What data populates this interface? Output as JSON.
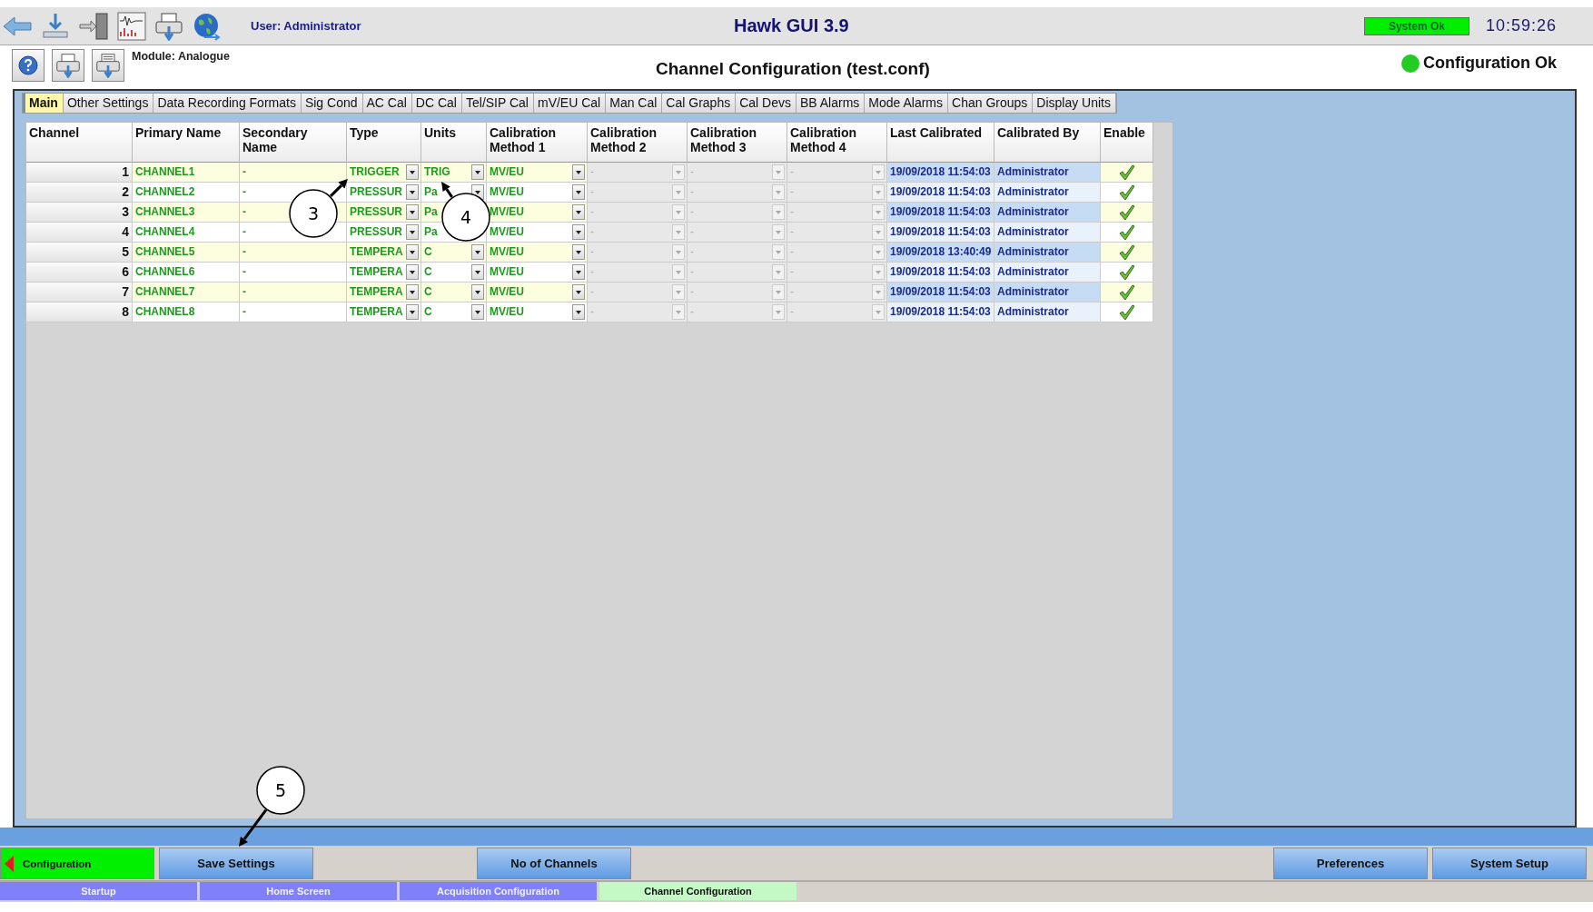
{
  "header": {
    "user": "User: Administrator",
    "title": "Hawk GUI 3.9",
    "system_status": {
      "text": "System Ok",
      "ok": true
    },
    "time": "10:59:26"
  },
  "subheader": {
    "module": "Module: Analogue",
    "title": "Channel Configuration (test.conf)",
    "config_status": {
      "text": "Configuration Ok",
      "ok": true
    }
  },
  "tabs": [
    {
      "label": "Main",
      "selected": true
    },
    {
      "label": "Other Settings",
      "selected": false
    },
    {
      "label": "Data Recording Formats",
      "selected": false
    },
    {
      "label": "Sig Cond",
      "selected": false
    },
    {
      "label": "AC Cal",
      "selected": false
    },
    {
      "label": "DC Cal",
      "selected": false
    },
    {
      "label": "Tel/SIP Cal",
      "selected": false
    },
    {
      "label": "mV/EU Cal",
      "selected": false
    },
    {
      "label": "Man Cal",
      "selected": false
    },
    {
      "label": "Cal Graphs",
      "selected": false
    },
    {
      "label": "Cal Devs",
      "selected": false
    },
    {
      "label": "BB Alarms",
      "selected": false
    },
    {
      "label": "Mode Alarms",
      "selected": false
    },
    {
      "label": "Chan Groups",
      "selected": false
    },
    {
      "label": "Display Units",
      "selected": false
    }
  ],
  "table": {
    "columns": [
      "Channel",
      "Primary Name",
      "Secondary Name",
      "Type",
      "Units",
      "Calibration Method 1",
      "Calibration Method 2",
      "Calibration Method 3",
      "Calibration Method 4",
      "Last Calibrated",
      "Calibrated By",
      "Enable"
    ],
    "rows": [
      {
        "channel": "1",
        "primary_name": "CHANNEL1",
        "secondary_name": "-",
        "type": "TRIGGER",
        "units": "TRIG",
        "methods": [
          {
            "value": "MV/EU",
            "disabled": false
          },
          {
            "value": "-",
            "disabled": true
          },
          {
            "value": "-",
            "disabled": true
          },
          {
            "value": "-",
            "disabled": true
          }
        ],
        "last_calibrated": "19/09/2018 11:54:03",
        "calibrated_by": "Administrator",
        "enabled": true
      },
      {
        "channel": "2",
        "primary_name": "CHANNEL2",
        "secondary_name": "-",
        "type": "PRESSUR",
        "units": "Pa",
        "methods": [
          {
            "value": "MV/EU",
            "disabled": false
          },
          {
            "value": "-",
            "disabled": true
          },
          {
            "value": "-",
            "disabled": true
          },
          {
            "value": "-",
            "disabled": true
          }
        ],
        "last_calibrated": "19/09/2018 11:54:03",
        "calibrated_by": "Administrator",
        "enabled": true
      },
      {
        "channel": "3",
        "primary_name": "CHANNEL3",
        "secondary_name": "-",
        "type": "PRESSUR",
        "units": "Pa",
        "methods": [
          {
            "value": "MV/EU",
            "disabled": false
          },
          {
            "value": "-",
            "disabled": true
          },
          {
            "value": "-",
            "disabled": true
          },
          {
            "value": "-",
            "disabled": true
          }
        ],
        "last_calibrated": "19/09/2018 11:54:03",
        "calibrated_by": "Administrator",
        "enabled": true
      },
      {
        "channel": "4",
        "primary_name": "CHANNEL4",
        "secondary_name": "-",
        "type": "PRESSUR",
        "units": "Pa",
        "methods": [
          {
            "value": "MV/EU",
            "disabled": false
          },
          {
            "value": "-",
            "disabled": true
          },
          {
            "value": "-",
            "disabled": true
          },
          {
            "value": "-",
            "disabled": true
          }
        ],
        "last_calibrated": "19/09/2018 11:54:03",
        "calibrated_by": "Administrator",
        "enabled": true
      },
      {
        "channel": "5",
        "primary_name": "CHANNEL5",
        "secondary_name": "-",
        "type": "TEMPERA",
        "units": "C",
        "methods": [
          {
            "value": "MV/EU",
            "disabled": false
          },
          {
            "value": "-",
            "disabled": true
          },
          {
            "value": "-",
            "disabled": true
          },
          {
            "value": "-",
            "disabled": true
          }
        ],
        "last_calibrated": "19/09/2018 13:40:49",
        "calibrated_by": "Administrator",
        "enabled": true
      },
      {
        "channel": "6",
        "primary_name": "CHANNEL6",
        "secondary_name": "-",
        "type": "TEMPERA",
        "units": "C",
        "methods": [
          {
            "value": "MV/EU",
            "disabled": false
          },
          {
            "value": "-",
            "disabled": true
          },
          {
            "value": "-",
            "disabled": true
          },
          {
            "value": "-",
            "disabled": true
          }
        ],
        "last_calibrated": "19/09/2018 11:54:03",
        "calibrated_by": "Administrator",
        "enabled": true
      },
      {
        "channel": "7",
        "primary_name": "CHANNEL7",
        "secondary_name": "-",
        "type": "TEMPERA",
        "units": "C",
        "methods": [
          {
            "value": "MV/EU",
            "disabled": false
          },
          {
            "value": "-",
            "disabled": true
          },
          {
            "value": "-",
            "disabled": true
          },
          {
            "value": "-",
            "disabled": true
          }
        ],
        "last_calibrated": "19/09/2018 11:54:03",
        "calibrated_by": "Administrator",
        "enabled": true
      },
      {
        "channel": "8",
        "primary_name": "CHANNEL8",
        "secondary_name": "-",
        "type": "TEMPERA",
        "units": "C",
        "methods": [
          {
            "value": "MV/EU",
            "disabled": false
          },
          {
            "value": "-",
            "disabled": true
          },
          {
            "value": "-",
            "disabled": true
          },
          {
            "value": "-",
            "disabled": true
          }
        ],
        "last_calibrated": "19/09/2018 11:54:03",
        "calibrated_by": "Administrator",
        "enabled": true
      }
    ]
  },
  "buttons": [
    {
      "label": "Configuration",
      "kind": "back"
    },
    {
      "label": "Save Settings",
      "kind": "action"
    },
    {
      "label": "No of Channels",
      "kind": "action"
    },
    {
      "label": "Preferences",
      "kind": "action"
    },
    {
      "label": "System Setup",
      "kind": "action"
    }
  ],
  "nav_tabs": [
    {
      "label": "Startup",
      "selected": false
    },
    {
      "label": "Home Screen",
      "selected": false
    },
    {
      "label": "Acquisition Configuration",
      "selected": false
    },
    {
      "label": "Channel Configuration",
      "selected": true
    }
  ],
  "callouts": [
    {
      "label": "3"
    },
    {
      "label": "4"
    },
    {
      "label": "5"
    }
  ]
}
